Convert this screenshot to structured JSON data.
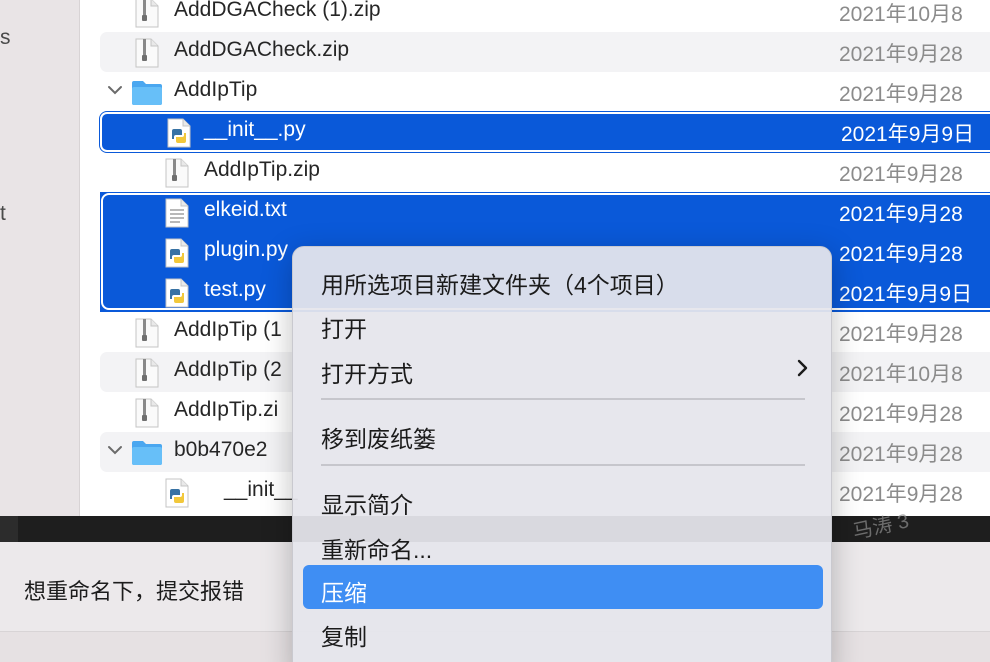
{
  "sidebar": {
    "fragments": [
      "s",
      "t"
    ]
  },
  "files": [
    {
      "name": "AddDGACheck (1).zip",
      "date": "2021年10月8",
      "icon": "zip-icon"
    },
    {
      "name": "AddDGACheck.zip",
      "date": "2021年9月28",
      "icon": "zip-icon"
    },
    {
      "name": "AddIpTip",
      "date": "2021年9月28",
      "icon": "folder-icon"
    },
    {
      "name": "__init__.py",
      "date": "2021年9月9日",
      "icon": "python-file-icon"
    },
    {
      "name": "AddIpTip.zip",
      "date": "2021年9月28",
      "icon": "zip-icon"
    },
    {
      "name": "elkeid.txt",
      "date": "2021年9月28",
      "icon": "text-file-icon"
    },
    {
      "name": "plugin.py",
      "date": "2021年9月28",
      "icon": "python-file-icon"
    },
    {
      "name": "test.py",
      "date": "2021年9月9日",
      "icon": "python-file-icon"
    },
    {
      "name": "AddIpTip (1",
      "date": "2021年9月28",
      "icon": "zip-icon"
    },
    {
      "name": "AddIpTip (2",
      "date": "2021年10月8",
      "icon": "zip-icon"
    },
    {
      "name": "AddIpTip.zi",
      "date": "2021年9月28",
      "icon": "zip-icon"
    },
    {
      "name": "b0b470e2",
      "date": "2021年9月28",
      "icon": "folder-icon"
    },
    {
      "name": "__init__",
      "date": "2021年9月28",
      "icon": "python-file-icon"
    }
  ],
  "context_menu": {
    "new_folder_with_selection": "用所选项目新建文件夹（4个项目）",
    "open": "打开",
    "open_with": "打开方式",
    "move_to_trash": "移到废纸篓",
    "get_info": "显示简介",
    "rename": "重新命名...",
    "compress": "压缩",
    "copy": "复制"
  },
  "tooltip": {
    "text": "想重命名下，提交报错"
  },
  "watermark": {
    "text": "马涛 3"
  },
  "colors": {
    "selection": "#0a59d9",
    "menu_highlight": "#3f8ef3",
    "folder": "#5bb5f5"
  }
}
